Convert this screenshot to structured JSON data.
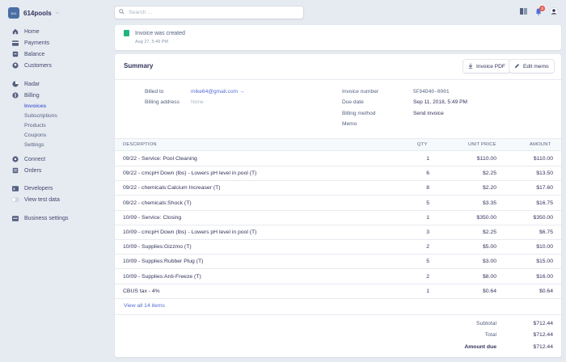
{
  "account": {
    "name": "614pools",
    "logo_text": "614"
  },
  "sidebar": {
    "items": [
      {
        "label": "Home",
        "icon": "home-icon"
      },
      {
        "label": "Payments",
        "icon": "payments-icon"
      },
      {
        "label": "Balance",
        "icon": "balance-icon"
      },
      {
        "label": "Customers",
        "icon": "customers-icon"
      },
      {
        "label": "Radar",
        "icon": "radar-icon"
      },
      {
        "label": "Billing",
        "icon": "billing-icon"
      },
      {
        "label": "Connect",
        "icon": "connect-icon"
      },
      {
        "label": "Orders",
        "icon": "orders-icon"
      },
      {
        "label": "Developers",
        "icon": "developers-icon"
      },
      {
        "label": "View test data",
        "icon": "toggle-icon"
      },
      {
        "label": "Business settings",
        "icon": "settings-icon"
      }
    ],
    "billing_sub": [
      "Invoices",
      "Subscriptions",
      "Products",
      "Coupons",
      "Settings"
    ],
    "active_sub": "Invoices"
  },
  "search": {
    "placeholder": "Search ..."
  },
  "notifications": {
    "count": "3"
  },
  "event": {
    "title": "Invoice was created",
    "time": "Aug 27, 5:49 PM"
  },
  "summary": {
    "title": "Summary",
    "invoice_pdf_label": "Invoice PDF",
    "edit_memo_label": "Edit memo",
    "billed_to_label": "Billed to",
    "billed_to_value": "mike64@gmail.com →",
    "billing_address_label": "Billing address",
    "billing_address_value": "None",
    "invoice_number_label": "Invoice number",
    "invoice_number_value": "5F94D40-0001",
    "due_date_label": "Due date",
    "due_date_value": "Sep 11, 2018, 5:49 PM",
    "billing_method_label": "Billing method",
    "billing_method_value": "Send invoice",
    "memo_label": "Memo"
  },
  "table": {
    "headers": {
      "description": "DESCRIPTION",
      "qty": "QTY",
      "unit_price": "UNIT PRICE",
      "amount": "AMOUNT"
    },
    "rows": [
      {
        "description": "09/22 - Service: Pool Cleaning",
        "qty": "1",
        "unit_price": "$110.00",
        "amount": "$110.00"
      },
      {
        "description": "09/22 - cmcpH Down (lbs) - Lowers pH level in pool (T)",
        "qty": "6",
        "unit_price": "$2.25",
        "amount": "$13.50"
      },
      {
        "description": "09/22 - chemicals:Calcium Increaser (T)",
        "qty": "8",
        "unit_price": "$2.20",
        "amount": "$17.60"
      },
      {
        "description": "09/22 - chemicals:Shock (T)",
        "qty": "5",
        "unit_price": "$3.35",
        "amount": "$16.75"
      },
      {
        "description": "10/09 - Service: Closing",
        "qty": "1",
        "unit_price": "$350.00",
        "amount": "$350.00"
      },
      {
        "description": "10/09 - cmcpH Down (lbs) - Lowers pH level in pool (T)",
        "qty": "3",
        "unit_price": "$2.25",
        "amount": "$6.75"
      },
      {
        "description": "10/09 - Supplies:Gizzmo (T)",
        "qty": "2",
        "unit_price": "$5.00",
        "amount": "$10.00"
      },
      {
        "description": "10/09 - Supplies:Rubber Plug (T)",
        "qty": "5",
        "unit_price": "$3.00",
        "amount": "$15.00"
      },
      {
        "description": "10/09 - Supplies:Anti-Freeze (T)",
        "qty": "2",
        "unit_price": "$8.00",
        "amount": "$16.00"
      },
      {
        "description": "CBUS tax - 4%",
        "qty": "1",
        "unit_price": "$0.64",
        "amount": "$0.64"
      }
    ],
    "view_all": "View all 14 items"
  },
  "totals": {
    "subtotal_label": "Subtotal",
    "subtotal": "$712.44",
    "total_label": "Total",
    "total": "$712.44",
    "amount_due_label": "Amount due",
    "amount_due": "$712.44"
  },
  "colors": {
    "accent": "#556cd6",
    "success": "#24b47e",
    "danger": "#e25950",
    "background": "#e6ebf1"
  }
}
